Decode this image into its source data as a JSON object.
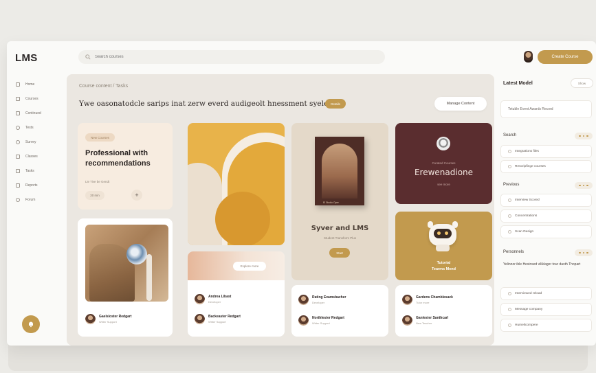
{
  "app": {
    "logo": "LMS"
  },
  "search": {
    "placeholder": "Search courses"
  },
  "header": {
    "primary_button": "Create Course"
  },
  "sidebar": {
    "items": [
      {
        "label": "Home"
      },
      {
        "label": "Courses"
      },
      {
        "label": "Continued"
      },
      {
        "label": "Tests"
      },
      {
        "label": "Survey"
      },
      {
        "label": "Classes"
      },
      {
        "label": "Tasks"
      },
      {
        "label": "Reports"
      },
      {
        "label": "Forum"
      }
    ]
  },
  "main": {
    "breadcrumb": "Course content / Tasks",
    "headline": "Ywe oasonatodcle sarips inat zerw everd audigeolt hnessment syele.",
    "headline_pill": "Details",
    "headline_button": "Manage Content",
    "cards": {
      "recommendations": {
        "tag": "New Courses",
        "title": "Professional with recommendations",
        "subtitle": "Lie Tive be Gendt",
        "chip": "20 min",
        "plus": "+"
      },
      "banner_pill": "Explore more",
      "featured": {
        "book_caption": "El Studio Oper",
        "title": "Syver and LMS",
        "subtitle": "Student Transform Plus",
        "button": "Start"
      },
      "maroon": {
        "label": "Curated Courses",
        "title": "Erewenadione",
        "subtitle": "see more"
      },
      "robot": {
        "title_line1": "Tutorial",
        "title_line2": "Tearms Mend"
      }
    },
    "people": [
      {
        "name": "Gaelsloster Redgart",
        "sub": "Writer Support"
      },
      {
        "name": "Andrea Libast",
        "sub": "Developer"
      },
      {
        "name": "Backeaster Redgart",
        "sub": "Writer Support"
      },
      {
        "name": "Rating Examsbacher",
        "sub": "Developer"
      },
      {
        "name": "Northlester Redgart",
        "sub": "Writer Support"
      },
      {
        "name": "Gardens Chamblesack",
        "sub": "Tutor more"
      },
      {
        "name": "Ganlester Santhcarl",
        "sub": "New Teacher"
      }
    ]
  },
  "right": {
    "title": "Latest Model",
    "toggle": "Show",
    "box_text": "Tetuble Event Awards Record",
    "sections": [
      {
        "label": "Search",
        "items": [
          "Integrations files",
          "Rescripfinge courses"
        ]
      },
      {
        "label": "Previous",
        "items": [
          "Interview Scored",
          "Concentrations",
          "Scan Design"
        ]
      },
      {
        "label": "Personnels",
        "items": [
          "Interviewed reload",
          "Message company",
          "Humelicompere"
        ]
      }
    ],
    "paragraph": "Yelinnor ible Hesinsed viliklager tour dasth Thopart"
  }
}
